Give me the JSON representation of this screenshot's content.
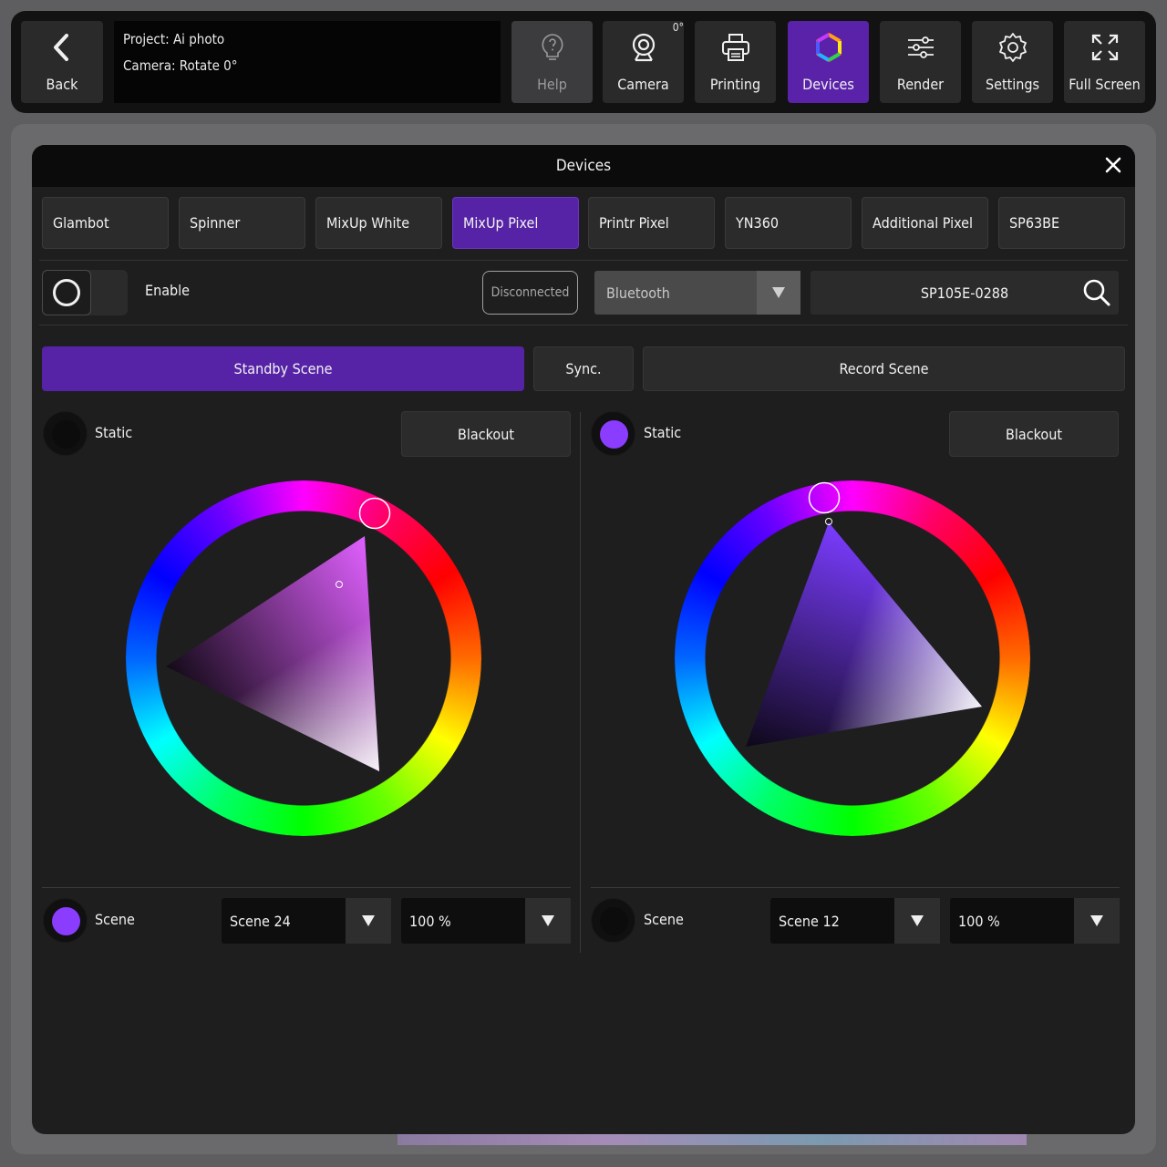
{
  "toolbar": {
    "back_label": "Back",
    "project_line": "Project: Ai photo",
    "camera_line": "Camera: Rotate 0°",
    "help_label": "Help",
    "camera_label": "Camera",
    "camera_badge": "0°",
    "printing_label": "Printing",
    "devices_label": "Devices",
    "render_label": "Render",
    "settings_label": "Settings",
    "fullscreen_label": "Full Screen"
  },
  "modal": {
    "title": "Devices",
    "tabs": [
      "Glambot",
      "Spinner",
      "MixUp White",
      "MixUp Pixel",
      "Printr Pixel",
      "YN360",
      "Additional Pixel",
      "SP63BE"
    ],
    "active_tab": "MixUp Pixel",
    "enable_label": "Enable",
    "enabled": false,
    "status_badge": "Disconnected",
    "connection_select": "Bluetooth",
    "device_id": "SP105E-0288",
    "scene_tabs": {
      "standby": "Standby Scene",
      "sync": "Sync.",
      "record": "Record Scene"
    },
    "active_scene_tab": "Standby Scene"
  },
  "standby": {
    "static_label": "Static",
    "static_color": "#0c0c0c",
    "blackout_label": "Blackout",
    "wheel_hue_color": "#ff44ff",
    "scene_label": "Scene",
    "scene_color": "#8a3cff",
    "scene_select": "Scene 24",
    "brightness_select": "100 %"
  },
  "record": {
    "static_label": "Static",
    "static_color": "#8a3cff",
    "blackout_label": "Blackout",
    "wheel_hue_color": "#8a3cff",
    "scene_label": "Scene",
    "scene_color": "#0c0c0c",
    "scene_select": "Scene 12",
    "brightness_select": "100 %"
  },
  "colors": {
    "accent": "#5623a6",
    "panel": "#1e1e1f",
    "button": "#2b2b2c"
  },
  "icons": {
    "back": "chevron-left-icon",
    "help": "lightbulb-question-icon",
    "camera": "webcam-icon",
    "printing": "printer-icon",
    "devices": "hexagon-rainbow-icon",
    "render": "sliders-icon",
    "settings": "gear-icon",
    "fullscreen": "expand-arrows-icon",
    "close": "close-icon",
    "search": "search-icon",
    "dropdown": "triangle-down-icon"
  }
}
